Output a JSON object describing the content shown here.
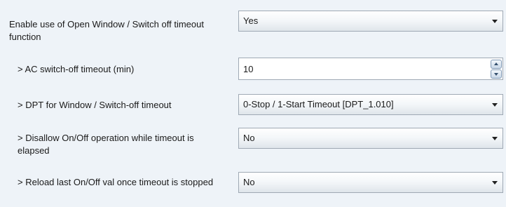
{
  "params": {
    "open_window": {
      "label": "Enable use of Open Window / Switch off timeout function",
      "value": "Yes"
    },
    "ac_timeout": {
      "label": "> AC switch-off timeout (min)",
      "value": "10"
    },
    "dpt": {
      "label": "> DPT for Window / Switch-off timeout",
      "value": "0-Stop / 1-Start Timeout [DPT_1.010]"
    },
    "disallow": {
      "label": "> Disallow On/Off operation while timeout is elapsed",
      "value": "No"
    },
    "reload": {
      "label": "> Reload last On/Off val once timeout is stopped",
      "value": "No"
    }
  },
  "icons": {
    "dropdown": "chevron-down-icon",
    "spin_up": "arrow-up-icon",
    "spin_down": "arrow-down-icon"
  }
}
